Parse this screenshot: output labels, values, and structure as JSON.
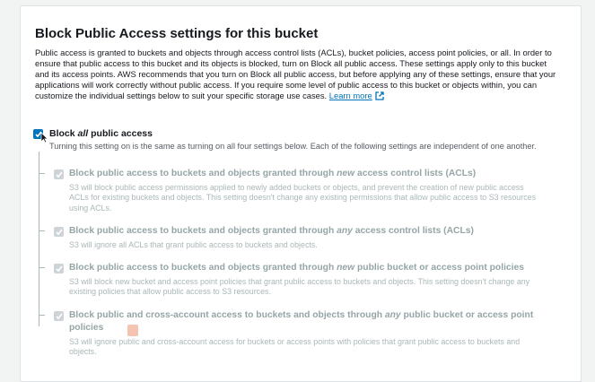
{
  "panel": {
    "title": "Block Public Access settings for this bucket",
    "description_lines": [
      "Public access is granted to buckets and objects through access control lists (ACLs), bucket policies, access point policies, or all. In order to",
      "ensure that public access to this bucket and its objects is blocked, turn on Block all public access. These settings apply only to this bucket",
      "and its access points. AWS recommends that you turn on Block all public access, but before applying any of these settings, ensure that your",
      "applications will work correctly without public access. If you require some level of public access to this bucket or objects within, you can",
      "customize the individual settings below to suit your specific storage use cases."
    ],
    "learn_more": "Learn more"
  },
  "block_all": {
    "label_pre": "Block ",
    "label_em": "all",
    "label_post": " public access",
    "checked": true,
    "subtitle": "Turning this setting on is the same as turning on all four settings below. Each of the following settings are independent of one another."
  },
  "settings": [
    {
      "label_pre": "Block public access to buckets and objects granted through ",
      "label_em": "new",
      "label_post": " access control lists (ACLs)",
      "desc_lines": [
        "S3 will block public access permissions applied to newly added buckets or objects, and prevent the creation of new public access",
        "ACLs for existing buckets and objects. This setting doesn't change any existing permissions that allow public access to S3 resources",
        "using ACLs."
      ],
      "checked": true
    },
    {
      "label_pre": "Block public access to buckets and objects granted through ",
      "label_em": "any",
      "label_post": " access control lists (ACLs)",
      "desc_lines": [
        "S3 will ignore all ACLs that grant public access to buckets and objects."
      ],
      "checked": true
    },
    {
      "label_pre": "Block public access to buckets and objects granted through ",
      "label_em": "new",
      "label_post": " public bucket or access point policies",
      "desc_lines": [
        "S3 will block new bucket and access point policies that grant public access to buckets and objects. This setting doesn't change any",
        "existing policies that allow public access to S3 resources."
      ],
      "checked": true
    },
    {
      "label_line1_pre": "Block public and cross-account access to buckets and objects through ",
      "label_em": "any",
      "label_line1_post": " public bucket or access point",
      "label_line2": "policies",
      "desc_lines": [
        "S3 will ignore public and cross-account access for buckets or access points with policies that grant public access to buckets and",
        "objects."
      ],
      "checked": true
    }
  ],
  "colors": {
    "accent": "#0073bb",
    "disabled_text": "#95a5a6",
    "background": "#f2f3f3"
  },
  "icons": [
    "external-link-icon",
    "checkmark-icon",
    "mouse-cursor-icon"
  ]
}
